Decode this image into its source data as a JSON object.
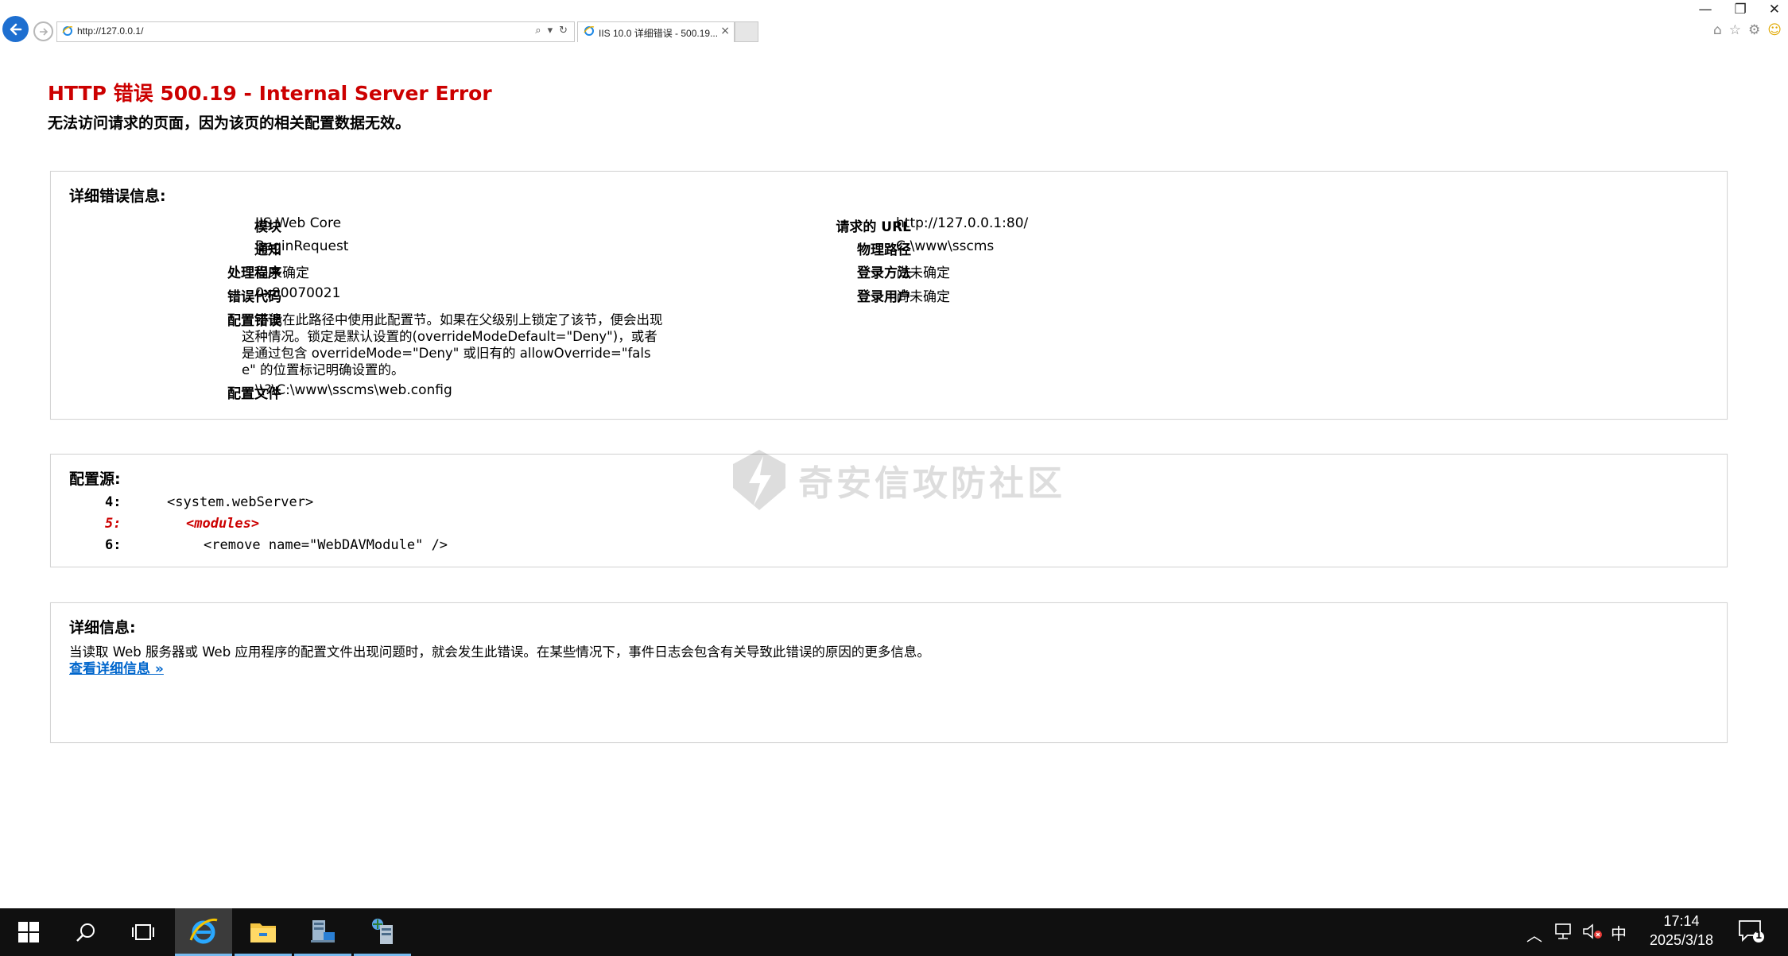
{
  "browser": {
    "address": "http://127.0.0.1/",
    "tab_title": "IIS 10.0 详细错误 - 500.19...",
    "tab_close": "×"
  },
  "error": {
    "title": "HTTP 错误 500.19 - Internal Server Error",
    "subtitle": "无法访问请求的页面，因为该页的相关配置数据无效。"
  },
  "details": {
    "heading": "详细错误信息:",
    "left": [
      {
        "label": "模块",
        "value": "IIS Web Core"
      },
      {
        "label": "通知",
        "value": "BeginRequest"
      },
      {
        "label": "处理程序",
        "value": "尚未确定"
      },
      {
        "label": "错误代码",
        "value": "0x80070021"
      }
    ],
    "config_error_label": "配置错误",
    "config_error_text": "不能在此路径中使用此配置节。如果在父级别上锁定了该节，便会出现这种情况。锁定是默认设置的(overrideModeDefault=\"Deny\")，或者是通过包含 overrideMode=\"Deny\" 或旧有的 allowOverride=\"false\" 的位置标记明确设置的。",
    "config_file_label": "配置文件",
    "config_file_value": "\\\\?\\C:\\www\\sscms\\web.config",
    "right": [
      {
        "label": "请求的 URL",
        "value": "http://127.0.0.1:80/"
      },
      {
        "label": "物理路径",
        "value": "C:\\www\\sscms"
      },
      {
        "label": "登录方法",
        "value": "尚未确定"
      },
      {
        "label": "登录用户",
        "value": "尚未确定"
      }
    ]
  },
  "config_source": {
    "heading": "配置源:",
    "lines": [
      {
        "num": "4:",
        "code": "<system.webServer>"
      },
      {
        "num": "5:",
        "code": "<modules>"
      },
      {
        "num": "6:",
        "code": "<remove name=\"WebDAVModule\" />"
      }
    ]
  },
  "more_info": {
    "heading": "详细信息:",
    "text": "当读取 Web 服务器或 Web 应用程序的配置文件出现问题时，就会发生此错误。在某些情况下，事件日志会包含有关导致此错误的原因的更多信息。",
    "link": "查看详细信息 »"
  },
  "watermark": "奇安信攻防社区",
  "taskbar": {
    "ime": "中",
    "time": "17:14",
    "date": "2025/3/18",
    "notification_count": "1"
  },
  "icons": [
    "back-arrow-icon",
    "forward-arrow-icon",
    "ie-icon",
    "search-icon",
    "refresh-icon",
    "home-icon",
    "star-icon",
    "gear-icon",
    "smiley-icon",
    "windows-start-icon",
    "search-icon",
    "task-view-icon",
    "file-explorer-icon",
    "server-manager-icon",
    "speaker-muted-icon",
    "network-icon",
    "notification-icon"
  ]
}
